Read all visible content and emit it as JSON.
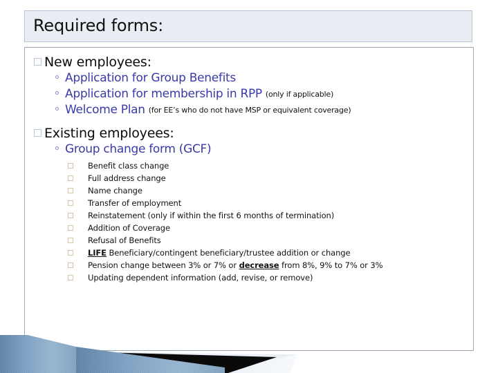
{
  "slide": {
    "title": "Required forms:",
    "theme": {
      "title_bg": "#e9edf4",
      "title_border": "#b6c2d2",
      "body_border": "#9aa9b5",
      "level2_text": "#3a3aa8",
      "level1_text": "#0b0b0b",
      "note_text": "#111111",
      "checkbox_border": "#d7c5ab",
      "banner_blue": "#6e95b8",
      "banner_dark": "#000000",
      "banner_light": "#e4eaf2"
    },
    "sections": [
      {
        "heading": "New employees:",
        "bullet": "square-bullet",
        "items": [
          {
            "text": "Application for Group Benefits",
            "note": ""
          },
          {
            "text": "Application for membership in RPP",
            "note": "(only if applicable)"
          },
          {
            "text": "Welcome Plan",
            "note": "(for EE’s who do not have MSP or equivalent coverage)"
          }
        ]
      },
      {
        "heading": "Existing employees:",
        "bullet": "square-bullet",
        "items": [
          {
            "text": "Group change form (GCF)",
            "note": ""
          }
        ],
        "checklist": [
          {
            "pre": "",
            "emph": "",
            "post": "Benefit class change"
          },
          {
            "pre": "",
            "emph": "",
            "post": "Full address change"
          },
          {
            "pre": "",
            "emph": "",
            "post": "Name change"
          },
          {
            "pre": "",
            "emph": "",
            "post": "Transfer of employment"
          },
          {
            "pre": "",
            "emph": "",
            "post": "Reinstatement (only if within the first 6 months of termination)"
          },
          {
            "pre": "",
            "emph": "",
            "post": "Addition of Coverage"
          },
          {
            "pre": "",
            "emph": "",
            "post": "Refusal of Benefits"
          },
          {
            "pre": "",
            "emph": "LIFE",
            "post": " Beneficiary/contingent beneficiary/trustee addition or change"
          },
          {
            "pre": "Pension change between 3% or 7% or ",
            "emph": "decrease",
            "post": " from 8%, 9% to 7% or 3%"
          },
          {
            "pre": "",
            "emph": "",
            "post": "Updating dependent information (add, revise, or remove)"
          }
        ]
      }
    ]
  }
}
